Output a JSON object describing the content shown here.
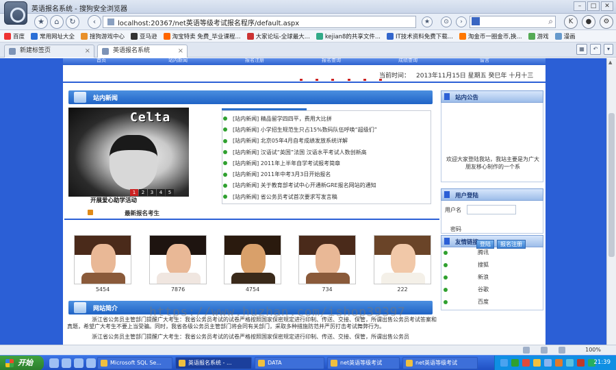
{
  "browser": {
    "window_title": "英语报名系统 - 搜狗安全浏览器",
    "address": "localhost:20367/net英语等级考试报名程序/default.aspx",
    "favorites": [
      "百度",
      "常用网址大全",
      "搜狗游戏中心",
      "亚马逊",
      "淘宝特卖 免费_毕业课程...",
      "大家论坛-全球最大...",
      "kejian8的共享文件...",
      "IT技术资料免费下载...",
      "淘金币一圈金币,换...",
      "游戏",
      "漫画"
    ],
    "tabs": [
      {
        "label": "新建标签页"
      },
      {
        "label": "英语报名系统"
      }
    ],
    "new_tab_label": "+",
    "zoom": "100%"
  },
  "site": {
    "nav": [
      "首页",
      "站内新闻",
      "报名注册",
      "报名查询",
      "成绩查询",
      "留言"
    ],
    "date_label": "当前时间：",
    "date_value": "2013年11月15日 星期五 癸巳年 十月十三",
    "news_section": "站内新闻",
    "slide_logo": "Celta",
    "slide_pages": [
      "1",
      "2",
      "3",
      "4",
      "5"
    ],
    "slide_caption": "开展爱心助学活动",
    "news": [
      "[站内新闻] 精品留学四四平，费用大比拼",
      "[站内新闻] 小学招生规范生只占15%数码队伍呼唤“超级们”",
      "[站内新闻] 北京05年4月自考成绩发放系统详解",
      "[站内新闻] 汉语试“英国”法国 汉语水平考试人数创新高",
      "[站内新闻] 2011年上半年自学考试报考简章",
      "[站内新闻] 2011年中考3月3日开始报名",
      "[站内新闻] 关于教育部考试中心开通新GRE报名网站的通知",
      "[站内新闻] 省公务员考试首次要求写发言稿"
    ],
    "newest_title": "最新报名考生",
    "students": [
      "5454",
      "7876",
      "4754",
      "734",
      "222"
    ],
    "intro_title": "网站简介",
    "intro_paragraphs": [
      "浙江省公务员主管部门提醒广大考生：我省公务员考试的试卷严格按照国家保密规定进行印制、传送、交接、保管，所谓出售公务员考试答案和真题，希望广大考生不要上当受骗。同时，我省各级公务员主管部门将会同有关部门，采取多种措施防范并严厉打击考试舞弊行为。",
      "浙江省公务员主管部门提醒广大考生：我省公务员考试的试卷严格按照国家保密规定进行印制、传送、交接、保管，所谓出售公务员"
    ],
    "notice_title": "站内公告",
    "notice_text": "欢迎大家登陆我站，我站主要是为广大朋友移心制作的一个系",
    "login_title": "用户登陆",
    "username_label": "用户名",
    "password_label": "密码",
    "login_button": "登陆",
    "register_button": "报名注册",
    "links_title": "友情链接",
    "links": [
      "腾讯",
      "搜狐",
      "新浪",
      "谷歌",
      "百度"
    ],
    "watermark": "https://www.huzhan.com/ishop39397"
  },
  "taskbar": {
    "start_label": "开始",
    "tasks": [
      "Microsoft SQL Se...",
      "英语报名系统 - ...",
      "DATA",
      "net英语等级考试",
      "net英语等级考试"
    ],
    "clock": "21:39"
  }
}
